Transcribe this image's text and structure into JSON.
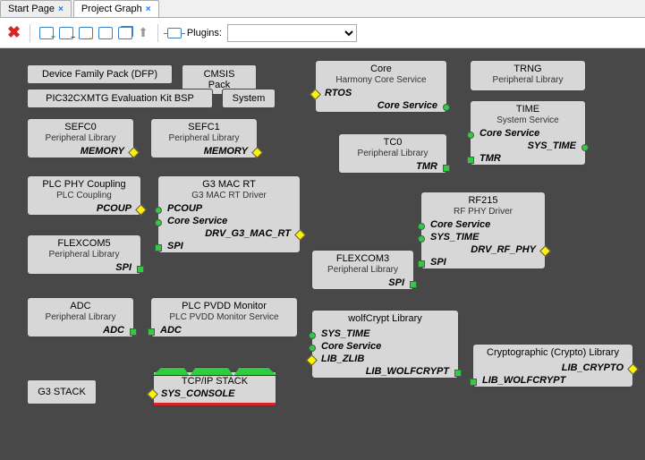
{
  "tabs": {
    "startPage": "Start Page",
    "projectGraph": "Project Graph"
  },
  "toolbar": {
    "pluginsLabel": "Plugins:"
  },
  "buttons": {
    "dfp": "Device Family Pack (DFP)",
    "cmsis": "CMSIS Pack",
    "bsp": "PIC32CXMTG Evaluation Kit BSP",
    "system": "System",
    "g3stack": "G3 STACK"
  },
  "blocks": {
    "core": {
      "title": "Core",
      "sub": "Harmony Core Service",
      "i1": "RTOS",
      "i2": "Core Service"
    },
    "trng": {
      "title": "TRNG",
      "sub": "Peripheral Library"
    },
    "time": {
      "title": "TIME",
      "sub": "System Service",
      "i1": "Core Service",
      "i2": "SYS_TIME",
      "i3": "TMR"
    },
    "sefc0": {
      "title": "SEFC0",
      "sub": "Peripheral Library",
      "i1": "MEMORY"
    },
    "sefc1": {
      "title": "SEFC1",
      "sub": "Peripheral Library",
      "i1": "MEMORY"
    },
    "tc0": {
      "title": "TC0",
      "sub": "Peripheral Library",
      "i1": "TMR"
    },
    "plcphy": {
      "title": "PLC PHY Coupling",
      "sub": "PLC Coupling",
      "i1": "PCOUP"
    },
    "g3mac": {
      "title": "G3 MAC RT",
      "sub": "G3 MAC RT Driver",
      "i1": "PCOUP",
      "i2": "Core Service",
      "i3": "DRV_G3_MAC_RT",
      "i4": "SPI"
    },
    "rf215": {
      "title": "RF215",
      "sub": "RF PHY Driver",
      "i1": "Core Service",
      "i2": "SYS_TIME",
      "i3": "DRV_RF_PHY",
      "i4": "SPI"
    },
    "flex5": {
      "title": "FLEXCOM5",
      "sub": "Peripheral Library",
      "i1": "SPI"
    },
    "flex3": {
      "title": "FLEXCOM3",
      "sub": "Peripheral Library",
      "i1": "SPI"
    },
    "adc": {
      "title": "ADC",
      "sub": "Peripheral Library",
      "i1": "ADC"
    },
    "pvdd": {
      "title": "PLC PVDD Monitor",
      "sub": "PLC PVDD Monitor Service",
      "i1": "ADC"
    },
    "wolf": {
      "title": "wolfCrypt Library",
      "i1": "SYS_TIME",
      "i2": "Core Service",
      "i3": "LIB_ZLIB",
      "i4": "LIB_WOLFCRYPT"
    },
    "crypto": {
      "title": "Cryptographic (Crypto) Library",
      "i1": "LIB_CRYPTO",
      "i2": "LIB_WOLFCRYPT"
    },
    "tcpip": {
      "title": "TCP/IP STACK",
      "i1": "SYS_CONSOLE"
    }
  }
}
